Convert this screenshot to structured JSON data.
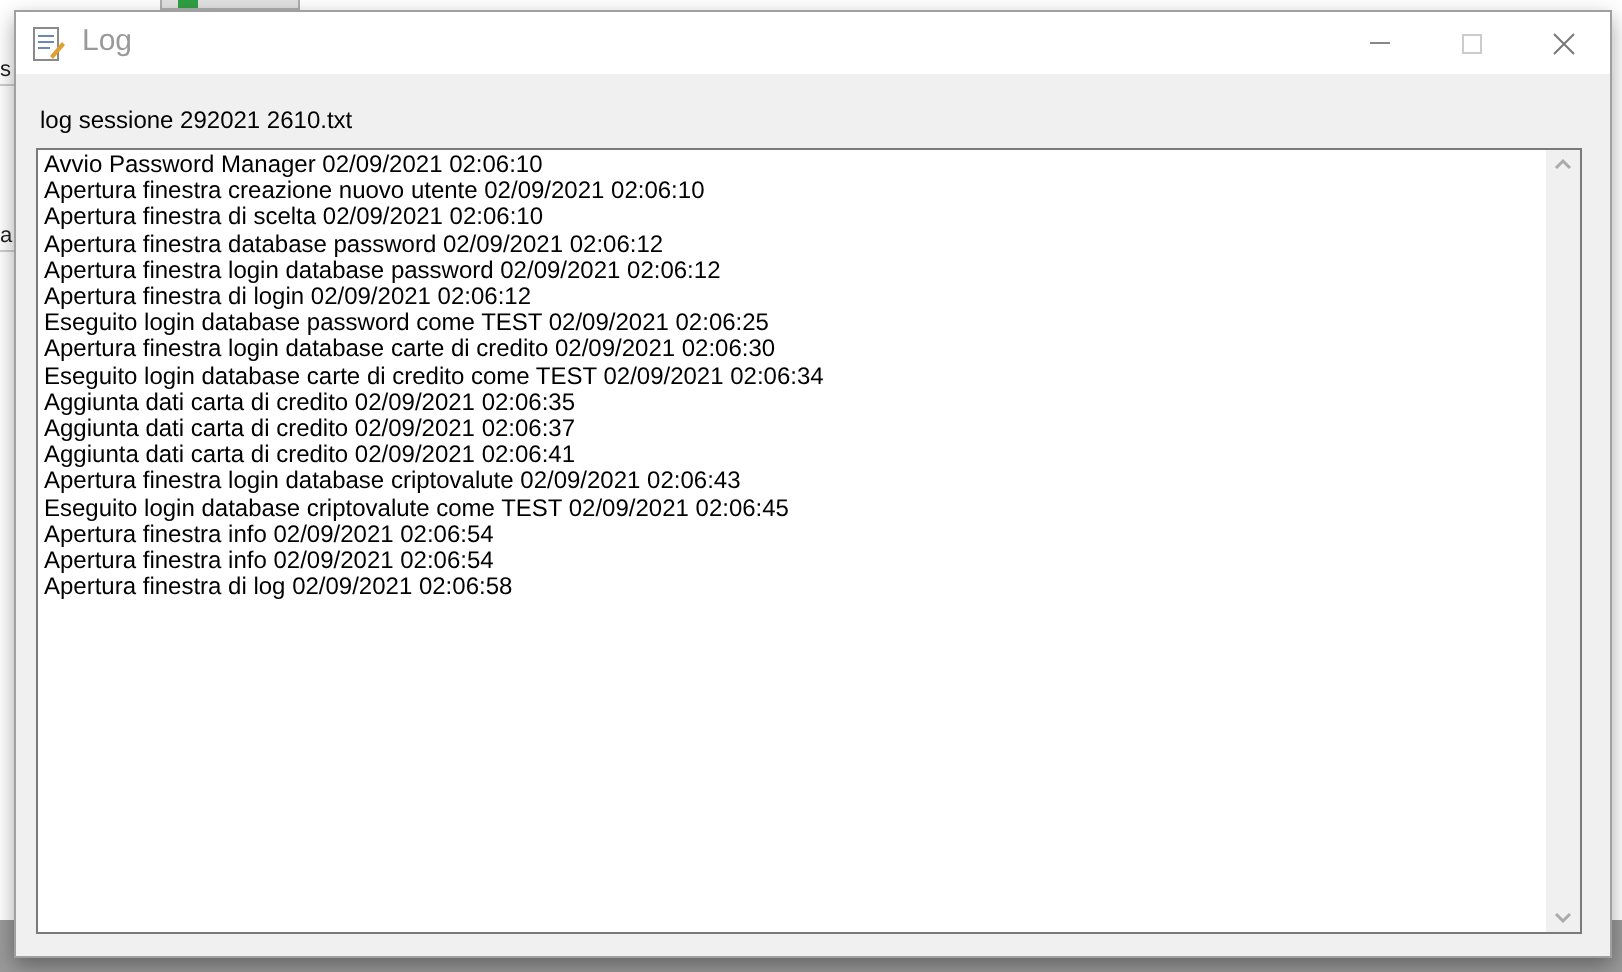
{
  "background_window": {
    "fragments": [
      "s",
      "a"
    ]
  },
  "window": {
    "title": "Log"
  },
  "file_label": "log sessione 292021 2610.txt",
  "log_lines": [
    "Avvio Password Manager 02/09/2021 02:06:10",
    "Apertura finestra creazione nuovo utente 02/09/2021 02:06:10",
    "Apertura finestra di scelta 02/09/2021 02:06:10",
    "Apertura finestra database password 02/09/2021 02:06:12",
    "Apertura finestra login database password 02/09/2021 02:06:12",
    "Apertura finestra di login 02/09/2021 02:06:12",
    "Eseguito login database password come TEST 02/09/2021 02:06:25",
    "Apertura finestra login database carte di credito 02/09/2021 02:06:30",
    "Eseguito login database carte di credito come TEST 02/09/2021 02:06:34",
    "Aggiunta dati carta di credito 02/09/2021 02:06:35",
    "Aggiunta dati carta di credito 02/09/2021 02:06:37",
    "Aggiunta dati carta di credito 02/09/2021 02:06:41",
    "Apertura finestra login database criptovalute 02/09/2021 02:06:43",
    "Eseguito login database criptovalute come TEST 02/09/2021 02:06:45",
    "Apertura finestra info 02/09/2021 02:06:54",
    "Apertura finestra info 02/09/2021 02:06:54",
    "Apertura finestra di log 02/09/2021 02:06:58"
  ]
}
